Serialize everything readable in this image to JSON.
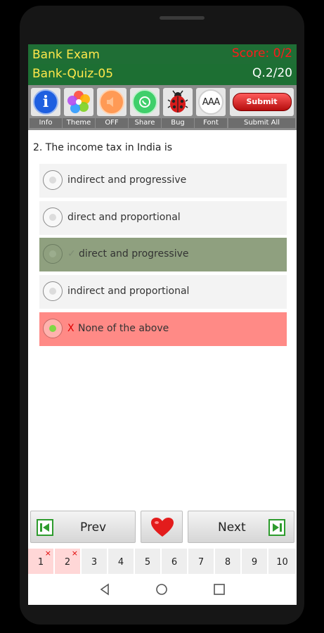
{
  "header": {
    "app_title": "Bank Exam",
    "score": "Score: 0/2",
    "quiz_name": "Bank-Quiz-05",
    "question_counter": "Q.2/20"
  },
  "toolbar": {
    "items": [
      {
        "label": "Info",
        "icon": "info-icon"
      },
      {
        "label": "Theme",
        "icon": "theme-flower-icon"
      },
      {
        "label": "OFF",
        "icon": "speaker-icon"
      },
      {
        "label": "Share",
        "icon": "whatsapp-icon"
      },
      {
        "label": "Bug",
        "icon": "ladybug-icon"
      },
      {
        "label": "Font",
        "icon": "font-size-icon"
      },
      {
        "label": "Submit All",
        "icon": "submit-pill-icon"
      }
    ],
    "font_icon_text": "AAA",
    "submit_pill_text": "Submit"
  },
  "question": {
    "text": "2. The income tax in India is",
    "options": [
      {
        "text": "indirect and progressive",
        "state": "default"
      },
      {
        "text": "direct and proportional",
        "state": "default"
      },
      {
        "text": "direct and progressive",
        "state": "correct",
        "mark": "✓"
      },
      {
        "text": "indirect and proportional",
        "state": "default"
      },
      {
        "text": "None of the above",
        "state": "wrong-selected",
        "mark": "X"
      }
    ]
  },
  "nav": {
    "prev_label": "Prev",
    "next_label": "Next"
  },
  "pages": [
    {
      "label": "1",
      "state": "wrong",
      "mark": "×"
    },
    {
      "label": "2",
      "state": "wrong",
      "mark": "×"
    },
    {
      "label": "3"
    },
    {
      "label": "4"
    },
    {
      "label": "5"
    },
    {
      "label": "6"
    },
    {
      "label": "7"
    },
    {
      "label": "8"
    },
    {
      "label": "9"
    },
    {
      "label": "10"
    }
  ],
  "colors": {
    "header_green": "#1f6e35",
    "title_yellow": "#ffe84b",
    "score_red": "#ff1a1a",
    "correct_bg": "#8fa07f",
    "wrong_bg": "#ff8a86"
  }
}
